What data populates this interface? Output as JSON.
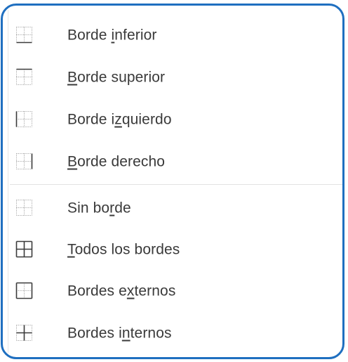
{
  "menu": {
    "items": [
      {
        "before": "Borde ",
        "accel": "i",
        "after": "nferior",
        "icon": "border-bottom-icon"
      },
      {
        "before": "",
        "accel": "B",
        "after": "orde superior",
        "icon": "border-top-icon"
      },
      {
        "before": "Borde i",
        "accel": "z",
        "after": "quierdo",
        "icon": "border-left-icon"
      },
      {
        "before": "",
        "accel": "B",
        "after": "orde derecho",
        "icon": "border-right-icon"
      },
      {
        "before": "Sin bo",
        "accel": "r",
        "after": "de",
        "icon": "no-border-icon"
      },
      {
        "before": "",
        "accel": "T",
        "after": "odos los bordes",
        "icon": "all-borders-icon"
      },
      {
        "before": "Bordes e",
        "accel": "x",
        "after": "ternos",
        "icon": "outside-borders-icon"
      },
      {
        "before": "Bordes i",
        "accel": "n",
        "after": "ternos",
        "icon": "inside-borders-icon"
      }
    ]
  },
  "colors": {
    "frame_accent": "#1f6fc0",
    "text": "#3a3a3a",
    "icon_solid": "#3a3a3a",
    "icon_dotted": "#9a9a9a"
  }
}
